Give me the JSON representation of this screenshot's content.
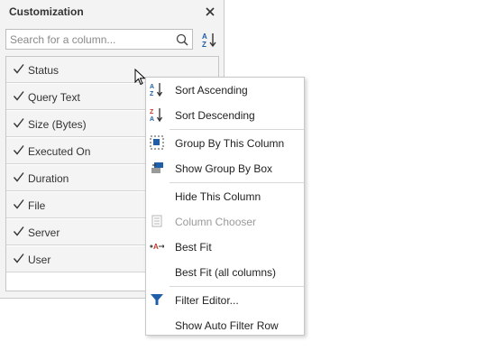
{
  "panel": {
    "title": "Customization",
    "search_placeholder": "Search for a column...",
    "columns": [
      {
        "label": "Status",
        "checked": true
      },
      {
        "label": "Query Text",
        "checked": true
      },
      {
        "label": "Size (Bytes)",
        "checked": true
      },
      {
        "label": "Executed On",
        "checked": true
      },
      {
        "label": "Duration",
        "checked": true
      },
      {
        "label": "File",
        "checked": true
      },
      {
        "label": "Server",
        "checked": true
      },
      {
        "label": "User",
        "checked": true
      }
    ]
  },
  "context_menu": {
    "items": [
      {
        "label": "Sort Ascending",
        "icon": "sort-ascending-icon",
        "enabled": true
      },
      {
        "label": "Sort Descending",
        "icon": "sort-descending-icon",
        "enabled": true
      },
      {
        "label": "Group By This Column",
        "icon": "group-by-column-icon",
        "enabled": true
      },
      {
        "label": "Show Group By Box",
        "icon": "group-by-box-icon",
        "enabled": true
      },
      {
        "label": "Hide This Column",
        "icon": "",
        "enabled": true
      },
      {
        "label": "Column Chooser",
        "icon": "column-chooser-icon",
        "enabled": false
      },
      {
        "label": "Best Fit",
        "icon": "best-fit-icon",
        "enabled": true
      },
      {
        "label": "Best Fit (all columns)",
        "icon": "",
        "enabled": true
      },
      {
        "label": "Filter Editor...",
        "icon": "filter-icon",
        "enabled": true
      },
      {
        "label": "Show Auto Filter Row",
        "icon": "",
        "enabled": true
      }
    ]
  },
  "colors": {
    "accent_blue": "#1f5fa8",
    "accent_red": "#c0392b",
    "disabled_text": "#9a9a9a"
  }
}
